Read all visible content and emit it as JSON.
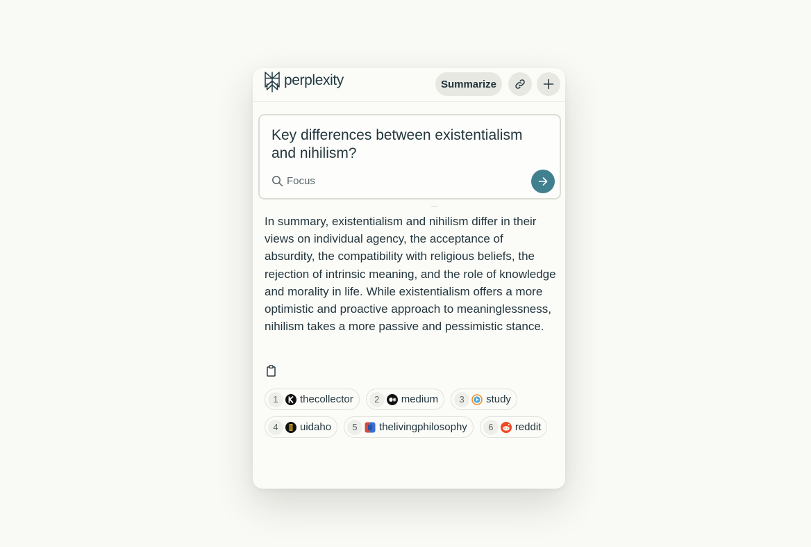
{
  "header": {
    "brand": "perplexity",
    "summarize_label": "Summarize",
    "link_icon": "link-icon",
    "plus_icon": "plus-icon"
  },
  "query": {
    "text": "Key differences between existentialism and nihilism?",
    "focus_label": "Focus",
    "submit_icon": "arrow-right-icon"
  },
  "answer": {
    "text": "In summary, existentialism and nihilism differ in their views on individual agency, the acceptance of absurdity, the compatibility with religious beliefs, the rejection of intrinsic meaning, and the role of knowledge and morality in life. While existentialism offers a more optimistic and proactive approach to meaninglessness, nihilism takes a more passive and pessimistic stance.",
    "copy_icon": "clipboard-icon"
  },
  "sources": [
    {
      "num": "1",
      "label": "thecollector",
      "icon": "thecollector-favicon"
    },
    {
      "num": "2",
      "label": "medium",
      "icon": "medium-favicon"
    },
    {
      "num": "3",
      "label": "study",
      "icon": "study-favicon"
    },
    {
      "num": "4",
      "label": "uidaho",
      "icon": "uidaho-favicon"
    },
    {
      "num": "5",
      "label": "thelivingphilosophy",
      "icon": "thelivingphilosophy-favicon"
    },
    {
      "num": "6",
      "label": "reddit",
      "icon": "reddit-favicon"
    }
  ],
  "colors": {
    "accent": "#40808f",
    "background": "#f9f9f5",
    "panel": "#fbfbf8",
    "text": "#23363d",
    "reddit": "#f04a22"
  }
}
